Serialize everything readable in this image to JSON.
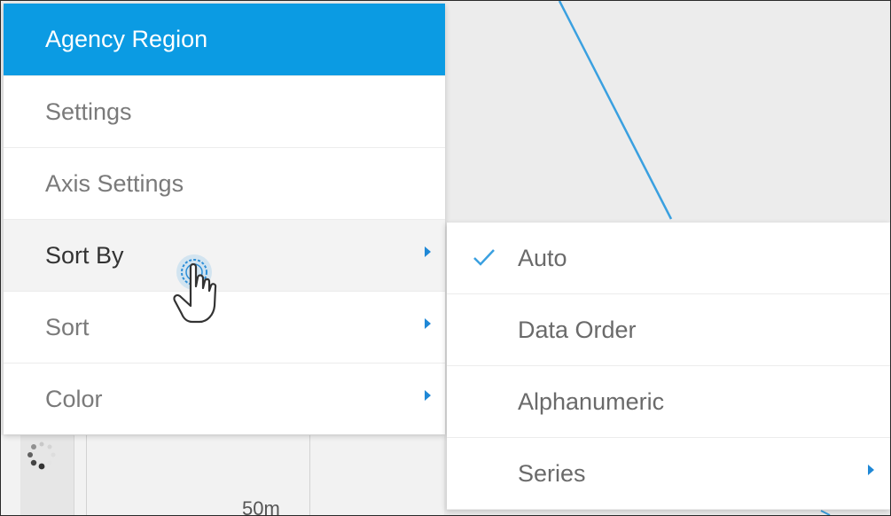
{
  "menu": {
    "title": "Agency Region",
    "items": [
      {
        "label": "Settings",
        "has_submenu": false
      },
      {
        "label": "Axis Settings",
        "has_submenu": false
      },
      {
        "label": "Sort By",
        "has_submenu": true,
        "active": true
      },
      {
        "label": "Sort",
        "has_submenu": true
      },
      {
        "label": "Color",
        "has_submenu": true
      }
    ]
  },
  "submenu": {
    "items": [
      {
        "label": "Auto",
        "checked": true
      },
      {
        "label": "Data Order"
      },
      {
        "label": "Alphanumeric"
      },
      {
        "label": "Series",
        "has_submenu": true
      }
    ]
  },
  "chart": {
    "axis_tick": "50m"
  },
  "colors": {
    "header_bg": "#0b9be3",
    "accent": "#1f88d6",
    "line": "#3aa0e0"
  },
  "icons": {
    "cursor": "hand-pointer-icon",
    "check": "check-icon",
    "spinner": "loading-spinner-icon",
    "submenu_arrow": "chevron-right-icon"
  }
}
